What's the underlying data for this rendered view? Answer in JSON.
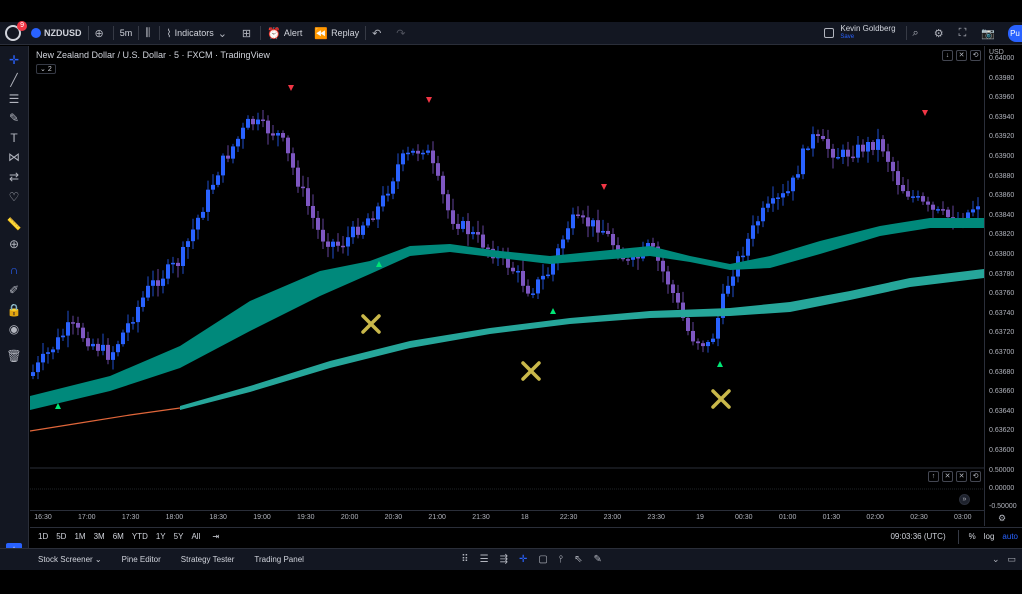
{
  "toolbar": {
    "notification_count": "9",
    "symbol": "NZDUSD",
    "interval": "5m",
    "indicators_label": "Indicators",
    "alert_label": "Alert",
    "replay_label": "Replay",
    "profile_name": "Kevin Goldberg",
    "profile_status": "Save",
    "publish_label": "Pu"
  },
  "chart": {
    "legend_title": "New Zealand Dollar / U.S. Dollar · 5 · FXCM · TradingView",
    "legend_count": "2",
    "currency_label": "USD",
    "price_labels": [
      "0.64000",
      "0.63980",
      "0.63960",
      "0.63940",
      "0.63920",
      "0.63900",
      "0.63880",
      "0.63860",
      "0.63840",
      "0.63820",
      "0.63800",
      "0.63780",
      "0.63760",
      "0.63740",
      "0.63720",
      "0.63700",
      "0.63680",
      "0.63660",
      "0.63640",
      "0.63620",
      "0.63600"
    ],
    "indicator_labels": [
      "0.50000",
      "0.00000",
      "-0.50000"
    ],
    "time_labels": [
      "16:30",
      "17:00",
      "17:30",
      "18:00",
      "18:30",
      "19:00",
      "19:30",
      "20:00",
      "20:30",
      "21:00",
      "21:30",
      "18",
      "22:30",
      "23:00",
      "23:30",
      "19",
      "00:30",
      "01:00",
      "01:30",
      "02:00",
      "02:30",
      "03:00"
    ],
    "colors": {
      "bull": "#2962ff",
      "bear": "#7e57c2",
      "ribbon_fast": "#00897b",
      "ribbon_slow": "#26a69a",
      "ribbon_slow_line": "#0097a7",
      "buy_marker": "#00e676",
      "sell_marker": "#f23645",
      "x_marker": "#c9b84a"
    }
  },
  "range_bar": {
    "ranges": [
      "1D",
      "5D",
      "1M",
      "3M",
      "6M",
      "YTD",
      "1Y",
      "5Y",
      "All"
    ],
    "clock": "09:03:36 (UTC)",
    "percent_label": "%",
    "log_label": "log",
    "auto_label": "auto"
  },
  "bottom_panel": {
    "tabs": [
      "Stock Screener",
      "Pine Editor",
      "Strategy Tester",
      "Trading Panel"
    ]
  }
}
